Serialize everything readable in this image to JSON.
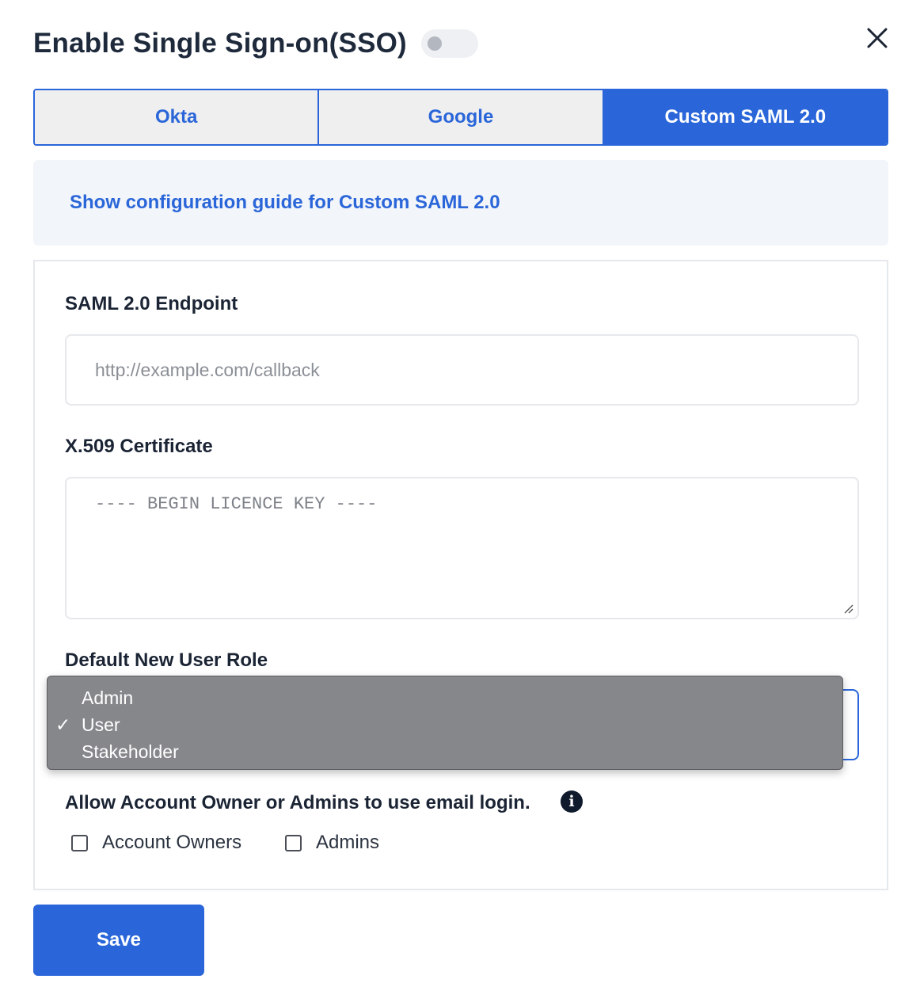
{
  "modal": {
    "title": "Enable Single Sign-on(SSO)",
    "toggle_enabled": false,
    "close_icon": "close-icon"
  },
  "tabs": [
    {
      "label": "Okta",
      "active": false
    },
    {
      "label": "Google",
      "active": false
    },
    {
      "label": "Custom SAML 2.0",
      "active": true
    }
  ],
  "guide": {
    "link_text": "Show configuration guide for Custom SAML 2.0"
  },
  "form": {
    "endpoint": {
      "label": "SAML 2.0 Endpoint",
      "placeholder": "http://example.com/callback",
      "value": ""
    },
    "certificate": {
      "label": "X.509 Certificate",
      "placeholder": "---- BEGIN LICENCE KEY ----",
      "value": ""
    },
    "role": {
      "label": "Default New User Role",
      "selected": "User",
      "options": [
        "Admin",
        "User",
        "Stakeholder"
      ],
      "check_mark": "✓"
    },
    "email_login": {
      "label": "Allow Account Owner or Admins to use email login.",
      "info_icon": "info-icon",
      "info_glyph": "i",
      "options": [
        {
          "label": "Account Owners",
          "checked": false
        },
        {
          "label": "Admins",
          "checked": false
        }
      ]
    }
  },
  "actions": {
    "save_label": "Save"
  },
  "colors": {
    "primary": "#2a66d9",
    "title": "#1e2a3b",
    "guide_bg": "#f2f5f9",
    "dropdown_bg": "#86878b"
  }
}
